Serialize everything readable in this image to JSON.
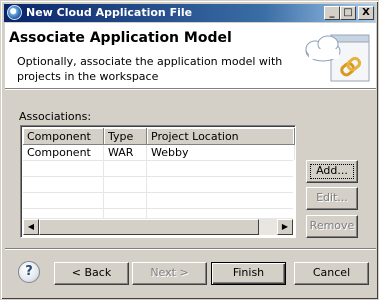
{
  "window": {
    "title": "New Cloud Application File",
    "controls": {
      "minimize": "_",
      "maximize": "□",
      "close": "X"
    }
  },
  "header": {
    "title": "Associate Application Model",
    "description": "Optionally, associate the application model with projects in the workspace",
    "banner_icon": "cloud-link-icon"
  },
  "associations": {
    "label": "Associations:",
    "columns": [
      "Component",
      "Type",
      "Project Location"
    ],
    "rows": [
      [
        "Component",
        "WAR",
        "Webby"
      ]
    ]
  },
  "side_buttons": {
    "add": "Add...",
    "edit": "Edit...",
    "remove": "Remove"
  },
  "footer": {
    "help_icon": "help-icon",
    "help_glyph": "?",
    "back": "< Back",
    "next": "Next >",
    "finish": "Finish",
    "cancel": "Cancel"
  },
  "colors": {
    "titlebar_start": "#0a246a",
    "titlebar_end": "#a6caf0",
    "face": "#d4d0c8"
  }
}
